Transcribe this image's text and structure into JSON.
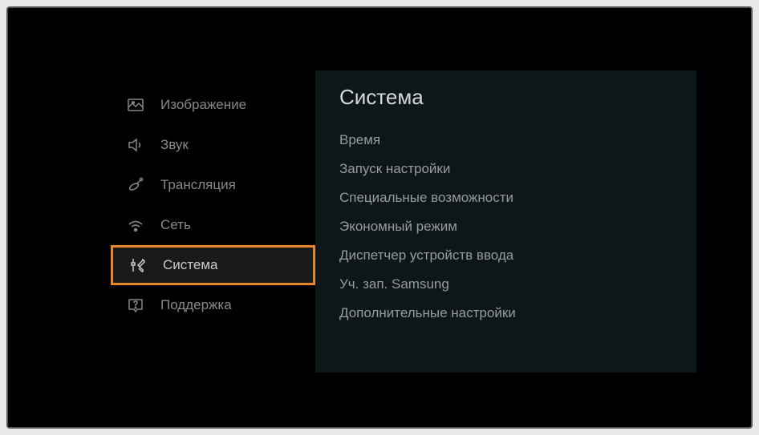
{
  "sidebar": {
    "items": [
      {
        "label": "Изображение"
      },
      {
        "label": "Звук"
      },
      {
        "label": "Трансляция"
      },
      {
        "label": "Сеть"
      },
      {
        "label": "Система"
      },
      {
        "label": "Поддержка"
      }
    ]
  },
  "content": {
    "title": "Система",
    "items": [
      {
        "label": "Время"
      },
      {
        "label": "Запуск настройки"
      },
      {
        "label": "Специальные возможности"
      },
      {
        "label": "Экономный режим"
      },
      {
        "label": "Диспетчер устройств ввода"
      },
      {
        "label": "Уч. зап. Samsung"
      },
      {
        "label": "Дополнительные настройки"
      }
    ]
  }
}
